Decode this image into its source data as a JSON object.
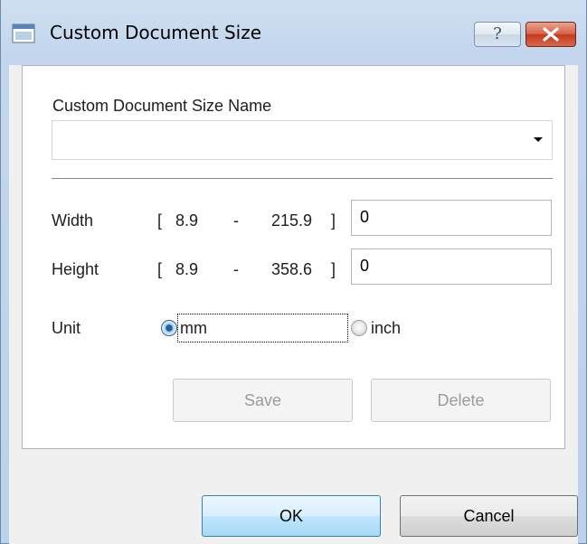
{
  "window": {
    "title": "Custom Document Size",
    "help_label": "?"
  },
  "form": {
    "name_label": "Custom Document Size Name",
    "name_value": "",
    "width": {
      "label": "Width",
      "open_bracket": "[",
      "min": "8.9",
      "dash": "-",
      "max": "215.9",
      "close_bracket": "]",
      "value": "0"
    },
    "height": {
      "label": "Height",
      "open_bracket": "[",
      "min": "8.9",
      "dash": "-",
      "max": "358.6",
      "close_bracket": "]",
      "value": "0"
    },
    "unit": {
      "label": "Unit",
      "options": [
        "mm",
        "inch"
      ],
      "selected": "mm"
    },
    "save_label": "Save",
    "delete_label": "Delete"
  },
  "buttons": {
    "ok_label": "OK",
    "cancel_label": "Cancel"
  },
  "icons": [
    "app-icon",
    "help-icon",
    "close-icon",
    "dropdown-arrow-icon"
  ],
  "colors": {
    "title_bar": "#c3d6ed",
    "close_button": "#c2391f",
    "ok_button": "#bee6fd",
    "selected_radio": "#1a5a99"
  }
}
